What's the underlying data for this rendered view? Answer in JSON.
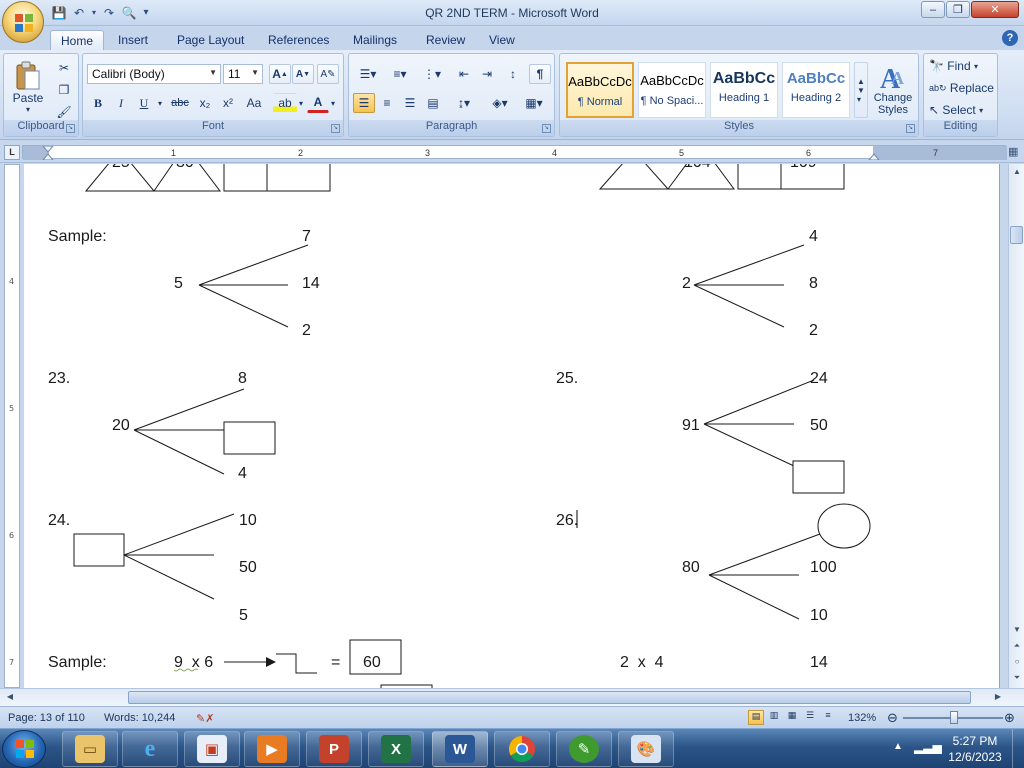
{
  "window": {
    "title": "QR 2ND TERM - Microsoft Word",
    "minimize": "‒",
    "maximize": "❐",
    "close": "✕"
  },
  "quick_access": {
    "save": "💾",
    "undo": "↶",
    "redo": "↷",
    "print_preview": "🔍",
    "customize": "▾"
  },
  "tabs": [
    "Home",
    "Insert",
    "Page Layout",
    "References",
    "Mailings",
    "Review",
    "View"
  ],
  "active_tab": "Home",
  "ribbon": {
    "clipboard": {
      "label": "Clipboard",
      "paste": "Paste"
    },
    "font": {
      "label": "Font",
      "family": "Calibri (Body)",
      "size": "11",
      "grow": "A",
      "shrink": "A",
      "bold": "B",
      "italic": "I",
      "underline": "U",
      "strike": "abc",
      "subscript": "x₂",
      "superscript": "x²",
      "change_case": "Aa",
      "highlight": "ab",
      "font_color": "A"
    },
    "paragraph": {
      "label": "Paragraph",
      "show_marks": "¶"
    },
    "styles": {
      "label": "Styles",
      "items": [
        {
          "preview": "AaBbCcDc",
          "name": "¶ Normal"
        },
        {
          "preview": "AaBbCcDc",
          "name": "¶ No Spaci..."
        },
        {
          "preview": "AaBbCc",
          "name": "Heading 1"
        },
        {
          "preview": "AaBbCc",
          "name": "Heading 2"
        }
      ],
      "change_styles": "Change Styles"
    },
    "editing": {
      "label": "Editing",
      "find": "Find",
      "replace": "Replace",
      "select": "Select"
    }
  },
  "ruler": {
    "numbers": [
      "1",
      "2",
      "3",
      "4",
      "5",
      "6",
      "7"
    ]
  },
  "document": {
    "top_partial_numbers": [
      "25",
      "30",
      "104",
      "109"
    ],
    "sample1": {
      "label": "Sample:",
      "left": {
        "root": "5",
        "top": "7",
        "middle": "14",
        "bottom": "2"
      },
      "right": {
        "root": "2",
        "top": "4",
        "middle": "8",
        "bottom": "2"
      }
    },
    "q23": {
      "label": "23.",
      "root": "20",
      "top": "8",
      "bottom": "4"
    },
    "q25": {
      "label": "25.",
      "root": "91",
      "top": "24",
      "middle": "50"
    },
    "q24": {
      "label": "24.",
      "top": "10",
      "middle": "50",
      "bottom": "5"
    },
    "q26": {
      "label": "26.",
      "root": "80",
      "middle": "100",
      "bottom": "10"
    },
    "sample2": {
      "label": "Sample:",
      "expr": "9  x 6",
      "equals": "=",
      "answer": "60",
      "right_expr": "2  x  4",
      "right_value": "14"
    }
  },
  "status": {
    "page": "Page: 13 of 110",
    "words": "Words: 10,244",
    "zoom": "132%",
    "zoom_level_percent": 132
  },
  "taskbar": {
    "apps": [
      "explorer",
      "internet-explorer",
      "media-center",
      "media-player",
      "powerpoint",
      "excel",
      "word",
      "chrome",
      "greenshot",
      "paint"
    ],
    "active_app": "word",
    "time": "5:27 PM",
    "date": "12/6/2023"
  },
  "colors": {
    "ribbon_blue": "#c5d5ea",
    "accent_gold": "#f6c24f",
    "taskbar_blue": "#2c5588"
  }
}
